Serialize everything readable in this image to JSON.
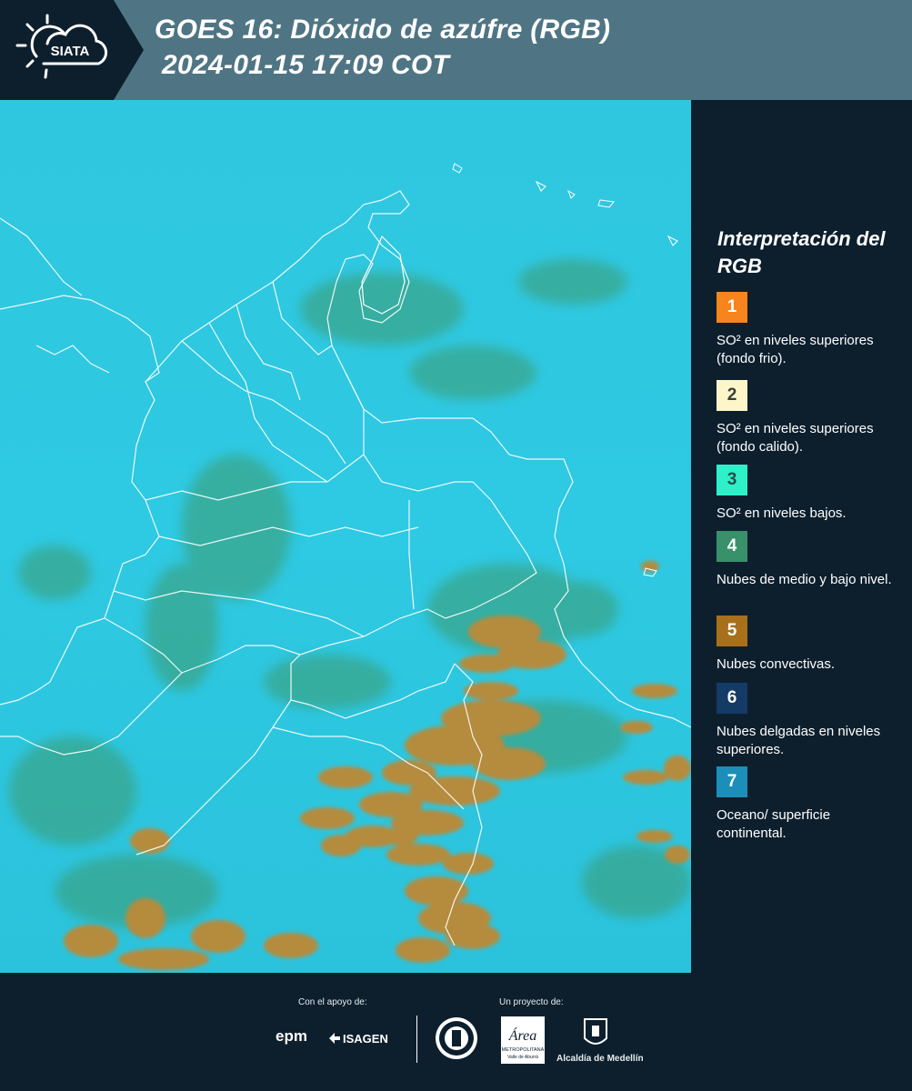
{
  "header": {
    "logo_text": "SIATA",
    "title_line1": "GOES 16: Dióxido de azúfre (RGB)",
    "title_line2": "2024-01-15 17:09 COT",
    "logo_icon": "sun-cloud-icon"
  },
  "map": {
    "description_icon": "satellite-map",
    "colors": {
      "background": "#2ccbe0",
      "convective": "#b68a3a",
      "mid_low": "#3d9a6d",
      "borders": "#ffffff"
    }
  },
  "legend": {
    "title": "Interpretación del RGB",
    "items": [
      {
        "number": "1",
        "color": "#f7841c",
        "text_color": "#ffffff",
        "label": "SO² en niveles superiores (fondo frio)."
      },
      {
        "number": "2",
        "color": "#fdf6c8",
        "text_color": "#3b3b3b",
        "label": "SO² en niveles superiores (fondo calido)."
      },
      {
        "number": "3",
        "color": "#2ef0c9",
        "text_color": "#2c4a4a",
        "label": "SO² en niveles bajos."
      },
      {
        "number": "4",
        "color": "#38916a",
        "text_color": "#ffffff",
        "label": "Nubes de medio y bajo nivel."
      },
      {
        "number": "5",
        "color": "#a8701a",
        "text_color": "#ffffff",
        "label": "Nubes convectivas."
      },
      {
        "number": "6",
        "color": "#143a66",
        "text_color": "#ffffff",
        "label": "Nubes delgadas en niveles superiores."
      },
      {
        "number": "7",
        "color": "#1b8fb8",
        "text_color": "#ffffff",
        "label": "Oceano/ superficie continental."
      }
    ]
  },
  "footer": {
    "support_label": "Con el apoyo de:",
    "project_label": "Un proyecto de:",
    "epm": "epm",
    "isagen": "ISAGEN",
    "metro_word": "Área",
    "metro_sub": "METROPOLITANA",
    "metro_sub2": "Valle de Aburrá",
    "alcaldia": "Alcaldía de Medellín"
  }
}
